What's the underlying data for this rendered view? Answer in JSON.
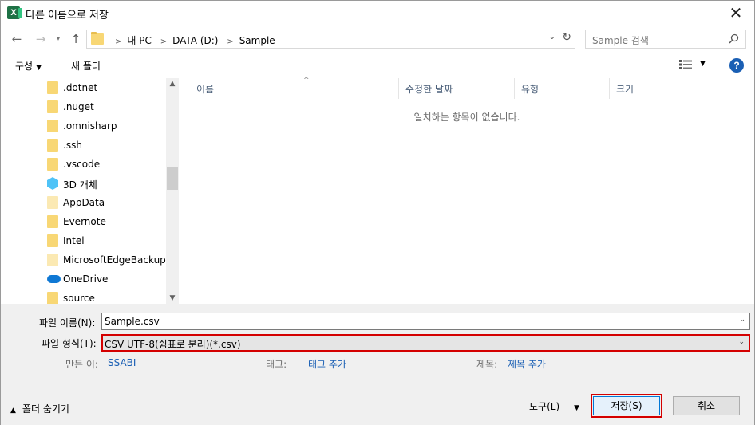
{
  "window": {
    "title": "다른 이름으로 저장",
    "app_icon_letter": "X"
  },
  "nav": {
    "breadcrumbs": [
      "내 PC",
      "DATA (D:)",
      "Sample"
    ],
    "search_placeholder": "Sample 검색"
  },
  "toolbar": {
    "organize_label": "구성",
    "new_folder_label": "새 폴더"
  },
  "tree": {
    "items": [
      {
        "label": ".dotnet",
        "icon": "folder-icon"
      },
      {
        "label": ".nuget",
        "icon": "folder-icon"
      },
      {
        "label": ".omnisharp",
        "icon": "folder-icon"
      },
      {
        "label": ".ssh",
        "icon": "folder-icon"
      },
      {
        "label": ".vscode",
        "icon": "folder-icon"
      },
      {
        "label": "3D 개체",
        "icon": "3d-objects-icon"
      },
      {
        "label": "AppData",
        "icon": "folder-icon"
      },
      {
        "label": "Evernote",
        "icon": "folder-icon"
      },
      {
        "label": "Intel",
        "icon": "folder-icon"
      },
      {
        "label": "MicrosoftEdgeBackups",
        "icon": "folder-icon"
      },
      {
        "label": "OneDrive",
        "icon": "onedrive-icon"
      },
      {
        "label": "source",
        "icon": "folder-icon"
      }
    ]
  },
  "filelist": {
    "columns": [
      "이름",
      "수정한 날짜",
      "유형",
      "크기"
    ],
    "empty_message": "일치하는 항목이 없습니다."
  },
  "form": {
    "filename_label": "파일 이름(N):",
    "filename_value": "Sample.csv",
    "filetype_label": "파일 형식(T):",
    "filetype_value": "CSV UTF-8(쉼표로 분리)(*.csv)",
    "author_label": "만든 이:",
    "author_value": "SSABI",
    "tags_label": "태그:",
    "tags_value": "태그 추가",
    "title_label": "제목:",
    "title_value": "제목 추가"
  },
  "footer": {
    "hide_folders_label": "폴더 숨기기",
    "tools_label": "도구(L)",
    "save_label": "저장(S)",
    "cancel_label": "취소"
  },
  "colors": {
    "highlight": "#d40000",
    "link": "#1a5fb4",
    "folder": "#f8d775"
  }
}
